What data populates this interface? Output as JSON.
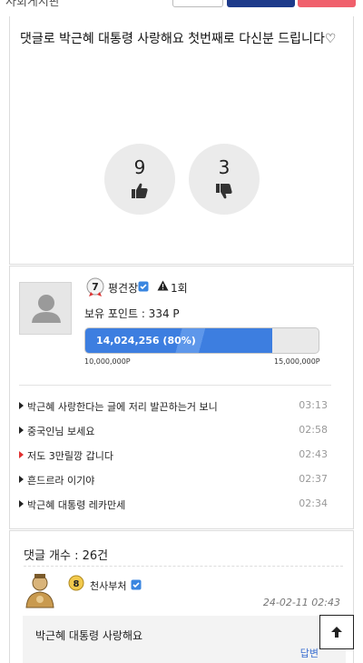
{
  "header": {
    "breadcrumb": "사회게시판"
  },
  "post": {
    "title": "댓글로 박근혜 대통령 사랑해요 첫번째로 다신분 드립니다♡",
    "upvotes": "9",
    "downvotes": "3"
  },
  "author": {
    "level": "7",
    "nickname": "평견장",
    "warning_count": "1회",
    "points": "보유 포인트 : 334 P",
    "progress_text": "14,024,256 (80%)",
    "progress_fraction": 0.8,
    "progress_min": "10,000,000P",
    "progress_max": "15,000,000P",
    "recent_posts": [
      {
        "title": "박근혜 사랑한다는 글에 저리 발끈하는거 보니",
        "time": "03:13",
        "marker": "black"
      },
      {
        "title": "중국인님 보세요",
        "time": "02:58",
        "marker": "black"
      },
      {
        "title": "저도 3만릴깡 갑니다",
        "time": "02:43",
        "marker": "red"
      },
      {
        "title": "흔드르라 이기야",
        "time": "02:37",
        "marker": "black"
      },
      {
        "title": "박근혜 대통령 레카만세",
        "time": "02:34",
        "marker": "black"
      }
    ]
  },
  "comments": {
    "count_label": "댓글 개수 : 26건",
    "first": {
      "level": "8",
      "nickname": "천사부처",
      "timestamp": "24-02-11 02:43",
      "body": "박근혜 대통령 사랑해요",
      "reply_label": "답변"
    }
  },
  "colors": {
    "accent_blue": "#3d7ee0",
    "navy_button": "#1d3a8a",
    "red_button": "#f0606c",
    "link": "#3b6fd0"
  },
  "icons": {
    "up": "thumbs-up-icon",
    "down": "thumbs-down-icon",
    "warning": "warning-triangle-icon",
    "verified": "verified-check-icon",
    "top": "arrow-up-icon"
  }
}
